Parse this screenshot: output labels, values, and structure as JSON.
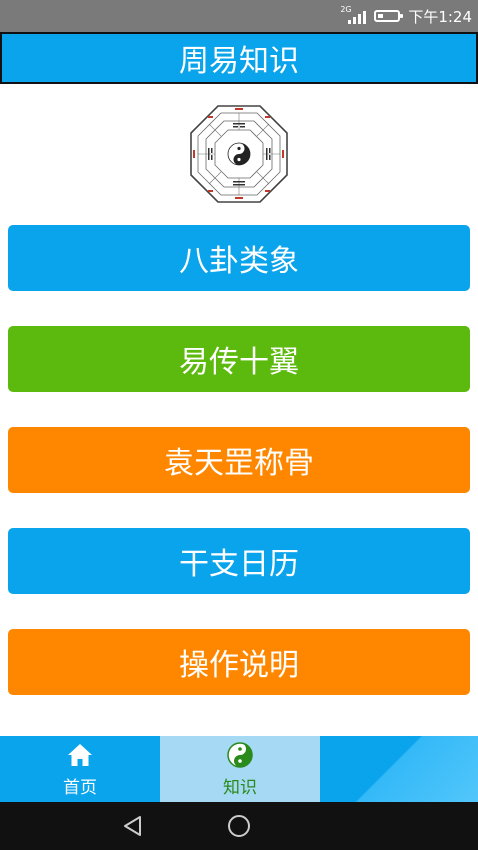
{
  "status_bar": {
    "network": "2G",
    "time": "下午1:24",
    "battery_level": 0.3,
    "signal_bars": 4
  },
  "header": {
    "title": "周易知识"
  },
  "menu": {
    "items": [
      {
        "label": "八卦类象",
        "color": "#0aa4ec"
      },
      {
        "label": "易传十翼",
        "color": "#5cba0e"
      },
      {
        "label": "袁天罡称骨",
        "color": "#ff8700"
      },
      {
        "label": "干支日历",
        "color": "#0aa4ec"
      },
      {
        "label": "操作说明",
        "color": "#ff8700"
      }
    ]
  },
  "bottom_nav": {
    "tabs": [
      {
        "label": "首页",
        "icon": "home-icon",
        "active": false
      },
      {
        "label": "知识",
        "icon": "taiji-icon",
        "active": true
      }
    ]
  },
  "system_nav": {
    "buttons": [
      "back-icon",
      "home-circle-icon"
    ]
  },
  "colors": {
    "primary": "#0aa4ec",
    "green": "#5cba0e",
    "orange": "#ff8700",
    "active_tab": "#a6d9f4",
    "active_tab_text": "#2a8a1c"
  }
}
